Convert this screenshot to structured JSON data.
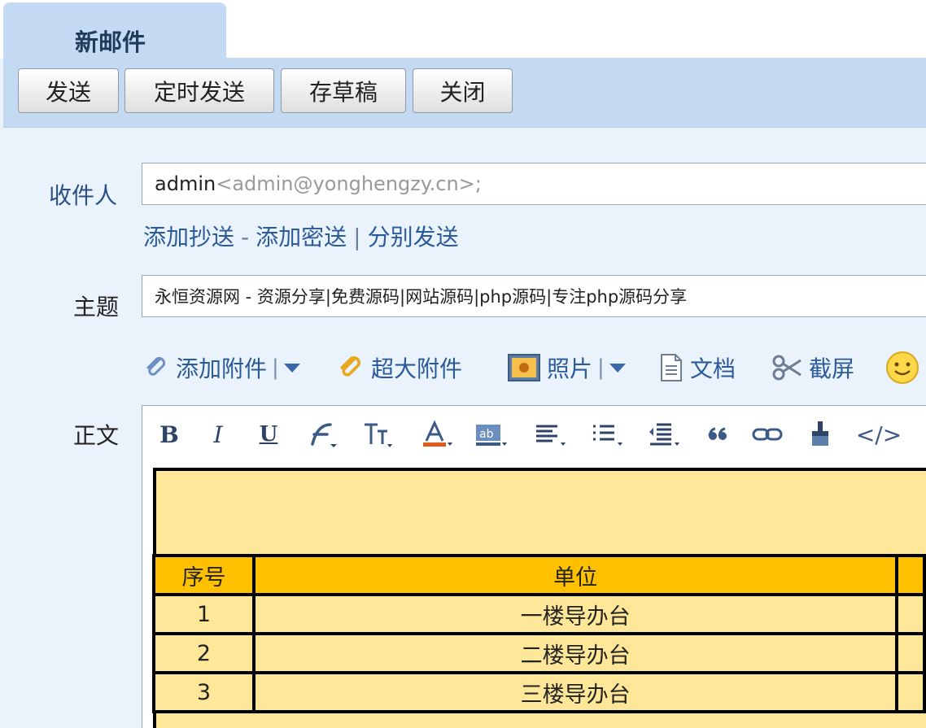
{
  "tab": {
    "title": "新邮件"
  },
  "toolbar": {
    "send": "发送",
    "schedule_send": "定时发送",
    "save_draft": "存草稿",
    "close": "关闭"
  },
  "recipient": {
    "label": "收件人",
    "name": "admin",
    "email": "<admin@yonghengzy.cn>;",
    "add_cc": "添加抄送",
    "dash": "-",
    "add_bcc": "添加密送",
    "bar": "|",
    "separate_send": "分别发送"
  },
  "subject": {
    "label": "主题",
    "value": "永恒资源网 - 资源分享|免费源码|网站源码|php源码|专注php源码分享"
  },
  "attachments": {
    "add_attachment": "添加附件",
    "large_attachment": "超大附件",
    "photo": "照片",
    "document": "文档",
    "screenshot": "截屏",
    "bar": "|"
  },
  "body": {
    "label": "正文",
    "toolbar": {
      "bold": "B",
      "italic": "I",
      "underline": "U",
      "html": "</>"
    },
    "table": {
      "headers": [
        "序号",
        "单位",
        ""
      ],
      "rows": [
        [
          "1",
          "一楼导办台",
          ""
        ],
        [
          "2",
          "二楼导办台",
          ""
        ],
        [
          "3",
          "三楼导办台",
          ""
        ]
      ]
    }
  },
  "colors": {
    "toolbar_bg": "#c4d9f2",
    "page_bg": "#eaf2fb",
    "link": "#2a5a9a",
    "table_header": "#ffc000",
    "table_cell": "#ffe799"
  }
}
